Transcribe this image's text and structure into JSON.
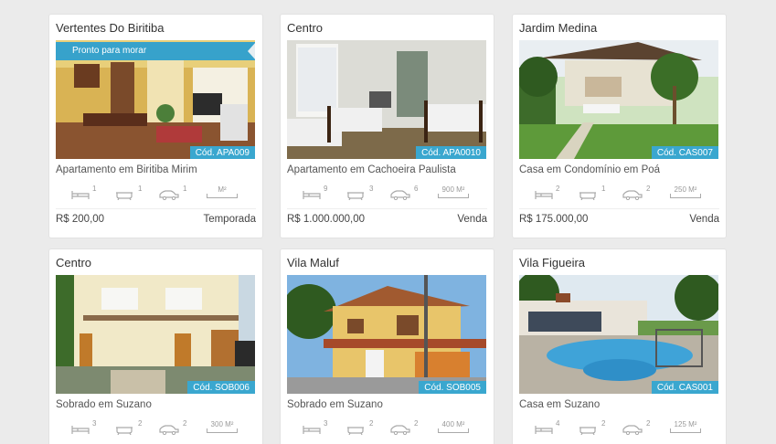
{
  "listings": [
    {
      "location": "Vertentes Do Biritiba",
      "ribbon": "Pronto para morar",
      "code": "Cód. APA009",
      "type": "Apartamento em Biritiba Mirim",
      "bedrooms": "1",
      "bathrooms": "1",
      "garages": "1",
      "area": "M²",
      "price": "R$ 200,00",
      "deal": "Temporada"
    },
    {
      "location": "Centro",
      "ribbon": "",
      "code": "Cód. APA0010",
      "type": "Apartamento em Cachoeira Paulista",
      "bedrooms": "9",
      "bathrooms": "3",
      "garages": "6",
      "area": "900 M²",
      "price": "R$ 1.000.000,00",
      "deal": "Venda"
    },
    {
      "location": "Jardim Medina",
      "ribbon": "",
      "code": "Cód. CAS007",
      "type": "Casa em Condomínio em Poá",
      "bedrooms": "2",
      "bathrooms": "1",
      "garages": "2",
      "area": "250 M²",
      "price": "R$ 175.000,00",
      "deal": "Venda"
    },
    {
      "location": "Centro",
      "ribbon": "",
      "code": "Cód. SOB006",
      "type": "Sobrado em Suzano",
      "bedrooms": "3",
      "bathrooms": "2",
      "garages": "2",
      "area": "300 M²",
      "price": "",
      "deal": ""
    },
    {
      "location": "Vila Maluf",
      "ribbon": "",
      "code": "Cód. SOB005",
      "type": "Sobrado em Suzano",
      "bedrooms": "3",
      "bathrooms": "2",
      "garages": "2",
      "area": "400 M²",
      "price": "",
      "deal": ""
    },
    {
      "location": "Vila Figueira",
      "ribbon": "",
      "code": "Cód. CAS001",
      "type": "Casa em Suzano",
      "bedrooms": "4",
      "bathrooms": "2",
      "garages": "2",
      "area": "125 M²",
      "price": "",
      "deal": ""
    }
  ],
  "icons": {
    "bedroom": "bed-icon",
    "bathroom": "bathtub-icon",
    "garage": "car-icon"
  },
  "colors": {
    "accent": "#3aa7cf",
    "background": "#ebebeb"
  }
}
